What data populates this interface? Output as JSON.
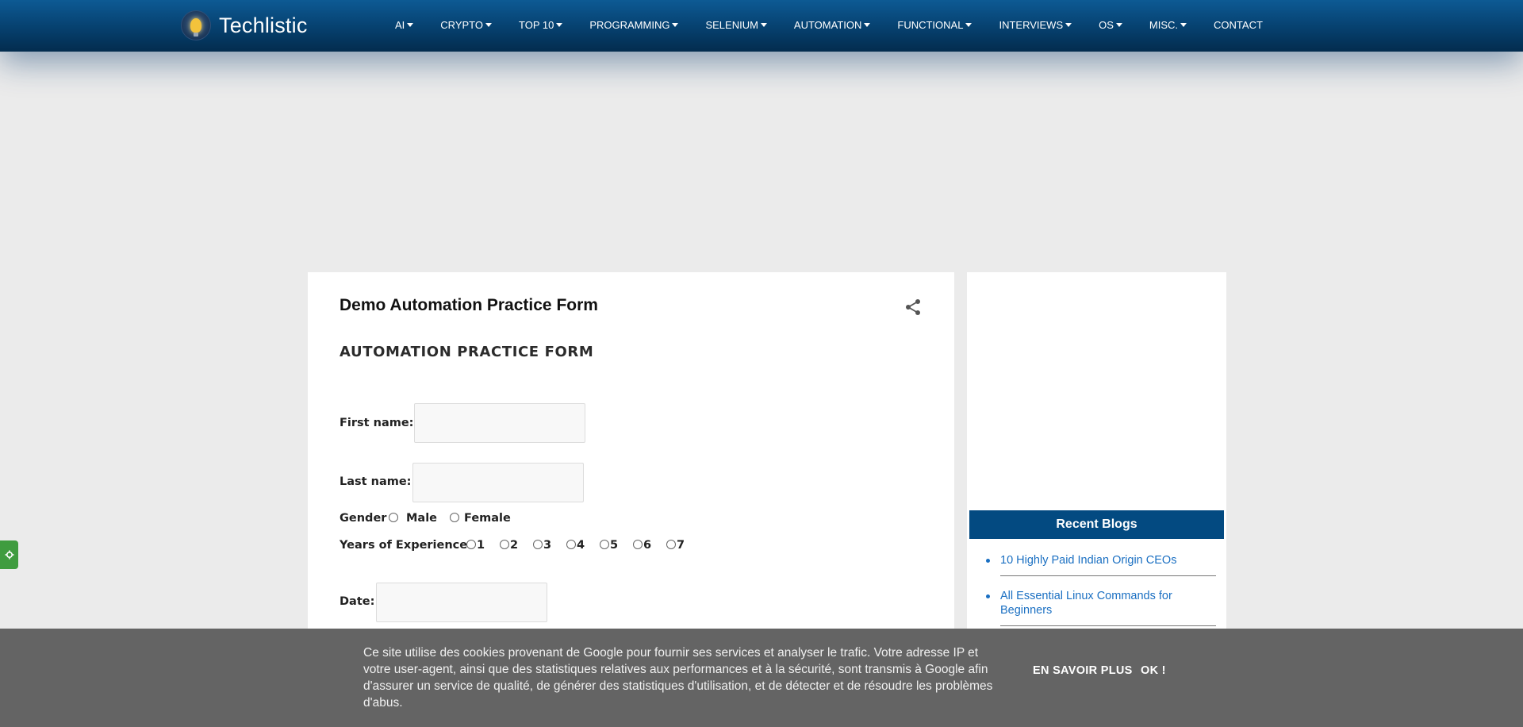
{
  "brand": {
    "name": "Techlistic"
  },
  "nav": {
    "items": [
      {
        "label": "AI",
        "dropdown": true
      },
      {
        "label": "CRYPTO",
        "dropdown": true
      },
      {
        "label": "TOP 10",
        "dropdown": true
      },
      {
        "label": "PROGRAMMING",
        "dropdown": true
      },
      {
        "label": "SELENIUM",
        "dropdown": true
      },
      {
        "label": "AUTOMATION",
        "dropdown": true
      },
      {
        "label": "FUNCTIONAL",
        "dropdown": true
      },
      {
        "label": "INTERVIEWS",
        "dropdown": true
      },
      {
        "label": "OS",
        "dropdown": true
      },
      {
        "label": "MISC.",
        "dropdown": true
      },
      {
        "label": "CONTACT",
        "dropdown": false
      }
    ]
  },
  "post": {
    "title": "Demo Automation Practice Form",
    "share_icon": "share-icon"
  },
  "form": {
    "heading": "AUTOMATION PRACTICE FORM",
    "first_name_label": "First name:",
    "first_name_value": "",
    "last_name_label": "Last name:",
    "last_name_value": "",
    "gender_label": "Gender",
    "gender_options": [
      "Male",
      "Female"
    ],
    "experience_label": "Years of Experience",
    "experience_options": [
      "1",
      "2",
      "3",
      "4",
      "5",
      "6",
      "7"
    ],
    "date_label": "Date:",
    "date_value": ""
  },
  "sidebar": {
    "recent_title": "Recent Blogs",
    "recent_items": [
      {
        "label": "10 Highly Paid Indian Origin CEOs"
      },
      {
        "label": "All Essential Linux Commands for Beginners"
      }
    ]
  },
  "cookie": {
    "text": "Ce site utilise des cookies provenant de Google pour fournir ses services et analyser le trafic. Votre adresse IP et votre user-agent, ainsi que des statistiques relatives aux performances et à la sécurité, sont transmis à Google afin d'assurer un service de qualité, de générer des statistiques d'utilisation, et de détecter et de résoudre les problèmes d'abus.",
    "learn_more": "EN SAVOIR PLUS",
    "ok": "OK !"
  },
  "colors": {
    "nav_bg": "#06406e",
    "recent_header_bg": "#034a81",
    "link": "#1a6fc2",
    "cookie_bg": "#646464",
    "settings_tab": "#3f9c3f"
  }
}
